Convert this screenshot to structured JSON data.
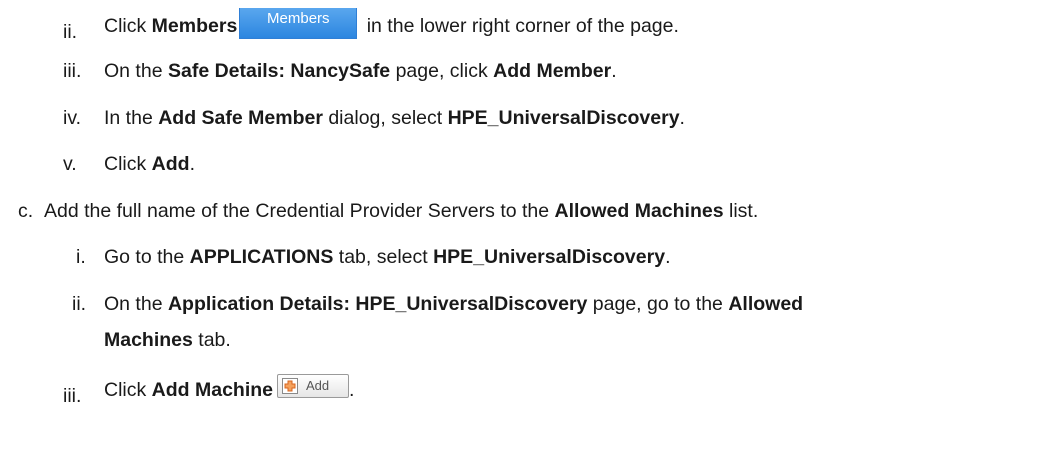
{
  "steps": [
    {
      "num": "ii.",
      "t1": "Click ",
      "b1": "Members",
      "button_label": "Members",
      "t2": " in the lower right corner of the page."
    },
    {
      "num": "iii.",
      "t1": "On the ",
      "b1": "Safe Details: NancySafe",
      "t2": " page, click ",
      "b2": "Add Member",
      "t3": "."
    },
    {
      "num": "iv.",
      "t1": "In the ",
      "b1": "Add Safe Member",
      "t2": " dialog, select ",
      "b2": "HPE_UniversalDiscovery",
      "t3": "."
    },
    {
      "num": "v.",
      "t1": "Click ",
      "b1": "Add",
      "t2": "."
    },
    {
      "num": "c.",
      "t1": "Add the full name of the Credential Provider Servers to the ",
      "b1": "Allowed Machines",
      "t2": " list."
    },
    {
      "num": "i.",
      "t1": "Go to the ",
      "b1": "APPLICATIONS",
      "t2": " tab, select ",
      "b2": "HPE_UniversalDiscovery",
      "t3": "."
    },
    {
      "num": "ii.",
      "t1": "On the ",
      "b1": "Application Details: HPE_UniversalDiscovery",
      "t2": " page, go to the ",
      "b2": "Allowed",
      "b3": "Machines",
      "t3": " tab."
    },
    {
      "num": "iii.",
      "t1": "Click ",
      "b1": "Add Machine",
      "button_label": "Add"
    }
  ],
  "colors": {
    "text": "#1a1a1a",
    "members_button": "#2c86e0",
    "add_icon": "#e8702a"
  },
  "icons": {
    "add_button_icon": "add-plus-icon"
  }
}
